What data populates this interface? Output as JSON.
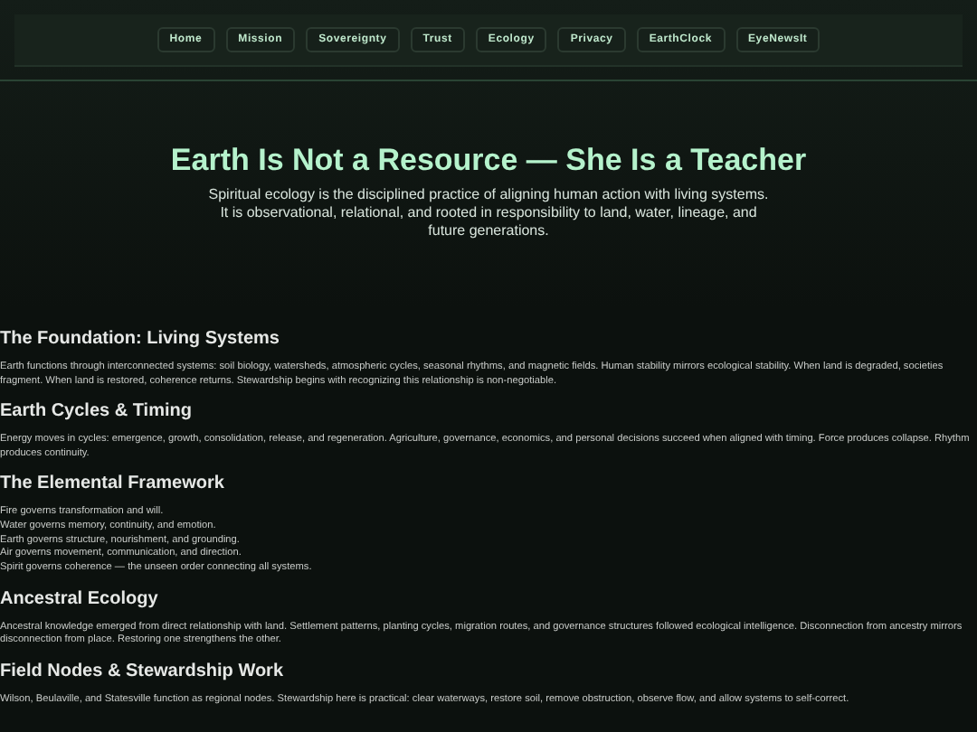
{
  "nav": [
    {
      "label": "Home"
    },
    {
      "label": "Mission"
    },
    {
      "label": "Sovereignty"
    },
    {
      "label": "Trust"
    },
    {
      "label": "Ecology"
    },
    {
      "label": "Privacy"
    },
    {
      "label": "EarthClock"
    },
    {
      "label": "EyeNewsIt"
    }
  ],
  "hero": {
    "title": "Earth Is Not a Resource — She Is a Teacher",
    "subtitle": "Spiritual ecology is the disciplined practice of aligning human action with living systems. It is observational, relational, and rooted in responsibility to land, water, lineage, and future generations."
  },
  "sections": [
    {
      "heading": "The Foundation: Living Systems",
      "kind": "paragraph",
      "text": "Earth functions through interconnected systems: soil biology, watersheds, atmospheric cycles, seasonal rhythms, and magnetic fields. Human stability mirrors ecological stability. When land is degraded, societies fragment. When land is restored, coherence returns. Stewardship begins with recognizing this relationship is non-negotiable."
    },
    {
      "heading": "Earth Cycles & Timing",
      "kind": "paragraph",
      "text": "Energy moves in cycles: emergence, growth, consolidation, release, and regeneration. Agriculture, governance, economics, and personal decisions succeed when aligned with timing. Force produces collapse. Rhythm produces continuity."
    },
    {
      "heading": "The Elemental Framework",
      "kind": "lines",
      "lines": [
        "Fire governs transformation and will.",
        "Water governs memory, continuity, and emotion.",
        "Earth governs structure, nourishment, and grounding.",
        "Air governs movement, communication, and direction.",
        "Spirit governs coherence — the unseen order connecting all systems."
      ]
    },
    {
      "heading": "Ancestral Ecology",
      "kind": "paragraph",
      "text": "Ancestral knowledge emerged from direct relationship with land. Settlement patterns, planting cycles, migration routes, and governance structures followed ecological intelligence. Disconnection from ancestry mirrors disconnection from place. Restoring one strengthens the other."
    },
    {
      "heading": "Field Nodes & Stewardship Work",
      "kind": "paragraph",
      "text": "Wilson, Beulaville, and Statesville function as regional nodes. Stewardship here is practical: clear waterways, restore soil, remove obstruction, observe flow, and allow systems to self-correct."
    }
  ]
}
